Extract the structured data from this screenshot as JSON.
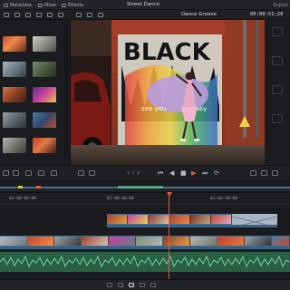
{
  "menu": {
    "items": [
      {
        "label": "Metadata",
        "icon": "metadata-icon"
      },
      {
        "label": "Mixer",
        "icon": "mixer-icon"
      },
      {
        "label": "Effects",
        "icon": "effects-icon"
      }
    ],
    "project_title": "Street Dance",
    "right_items": [
      {
        "label": "Export",
        "icon": "export-icon"
      }
    ]
  },
  "toolbar": {
    "timeline_name": "Dance Groove",
    "timecode": "00:00:51:20"
  },
  "viewer": {
    "mural_text": [
      "BLACK",
      "MATT",
      "see you",
      "Baby"
    ]
  },
  "colors": {
    "accent": "#e85a3d",
    "video_track": "#4a7fa8",
    "audio_track": "#2f7a55",
    "audio_wave": "#6fd39a"
  }
}
